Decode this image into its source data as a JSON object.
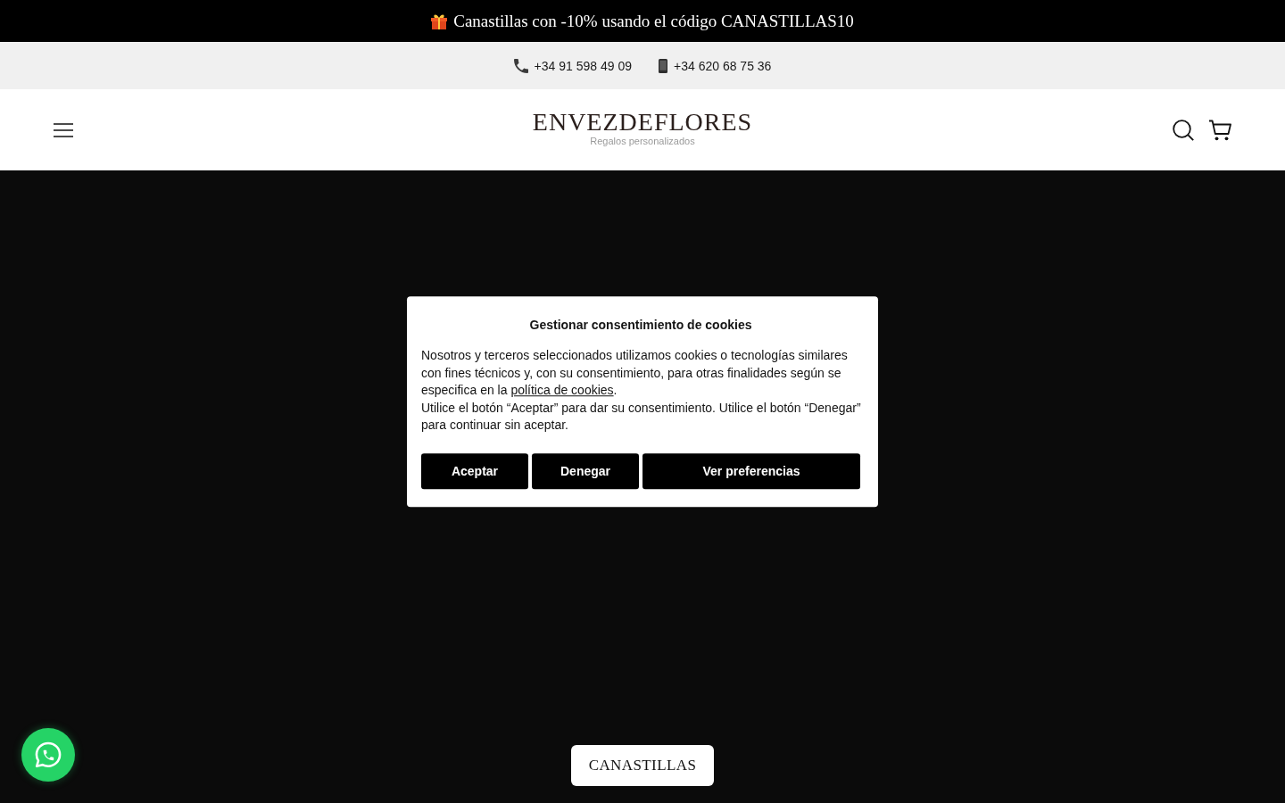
{
  "announcement": {
    "text": "Canastillas con -10% usando el código CANASTILLAS10"
  },
  "contact_bar": {
    "phones": [
      {
        "kind": "landline",
        "number": "+34 91 598 49 09"
      },
      {
        "kind": "mobile",
        "number": "+34 620 68 75 36"
      }
    ]
  },
  "header": {
    "logo": "ENVEZDEFLORES",
    "tagline": "Regalos personalizados"
  },
  "cookie_dialog": {
    "title": "Gestionar consentimiento de cookies",
    "paragraphs": [
      {
        "text": "Nosotros y terceros seleccionados utilizamos cookies o tecnologías similares con fines técnicos y, con su consentimiento, para otras finalidades según se especifica en la ",
        "link": "política de cookies",
        "after": "."
      },
      {
        "text": "Utilice el botón “Aceptar” para dar su consentimiento. Utilice el botón “Denegar” para continuar sin aceptar."
      }
    ],
    "buttons": [
      {
        "label": "Aceptar"
      },
      {
        "label": "Denegar"
      },
      {
        "label": "Ver preferencias"
      }
    ]
  },
  "hero": {
    "button": "CANASTILLAS"
  }
}
